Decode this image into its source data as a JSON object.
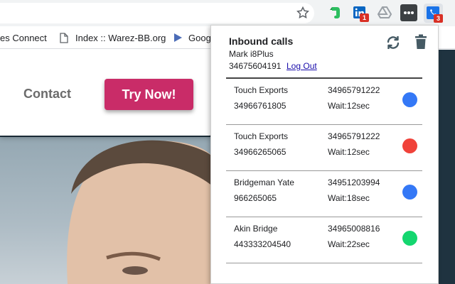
{
  "toolbar": {
    "extensions": [
      {
        "name": "evernote",
        "color": "#2dbe60"
      },
      {
        "name": "linkedin",
        "color": "#0a66c2",
        "badge": "1"
      },
      {
        "name": "google-drive",
        "color": "#9aa0a6"
      },
      {
        "name": "dots-extension",
        "color": "#3c4043"
      },
      {
        "name": "inbound-calls-extension",
        "color": "#1a73e8",
        "badge": "3"
      }
    ]
  },
  "bookmarks": [
    {
      "label": "es Connect"
    },
    {
      "label": "Index :: Warez-BB.org"
    },
    {
      "label": "Goog"
    }
  ],
  "page": {
    "contact_label": "Contact",
    "cta_label": "Try Now!",
    "cta_color": "#c92c68"
  },
  "popup": {
    "title": "Inbound calls",
    "user": "Mark i8Plus",
    "number": "34675604191",
    "logout_label": "Log Out",
    "calls": [
      {
        "name": "Touch Exports",
        "from": "34966761805",
        "to": "34965791222",
        "wait": "Wait:12sec",
        "status_color": "#3478f6"
      },
      {
        "name": "Touch Exports",
        "from": "34966265065",
        "to": "34965791222",
        "wait": "Wait:12sec",
        "status_color": "#f0423a"
      },
      {
        "name": "Bridgeman Yate",
        "from": "966265065",
        "to": "34951203994",
        "wait": "Wait:18sec",
        "status_color": "#3478f6"
      },
      {
        "name": "Akin Bridge",
        "from": "443333204540",
        "to": "34965008816",
        "wait": "Wait:22sec",
        "status_color": "#14d66f"
      }
    ]
  }
}
